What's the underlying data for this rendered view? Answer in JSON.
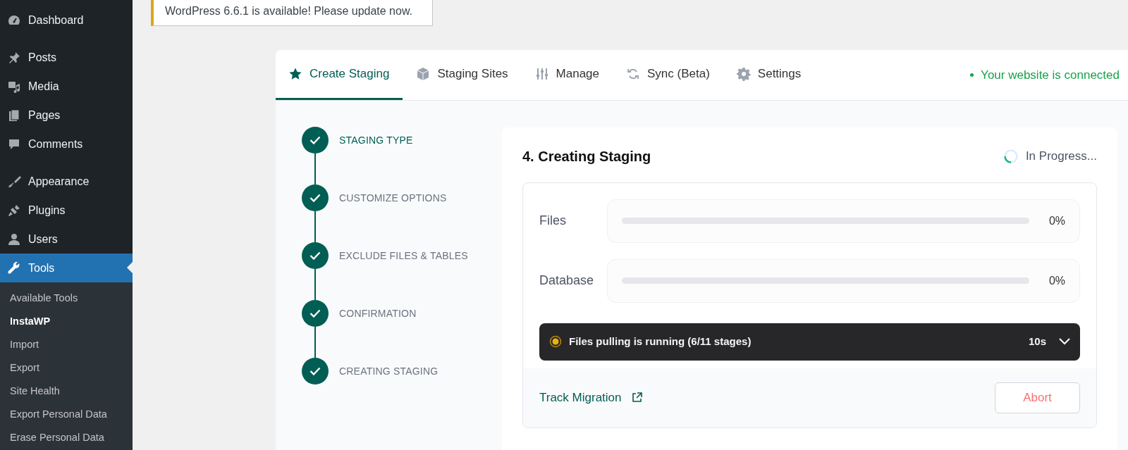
{
  "sidebar": {
    "items": [
      {
        "label": "Dashboard",
        "selected": false
      },
      {
        "label": "Posts",
        "selected": false
      },
      {
        "label": "Media",
        "selected": false
      },
      {
        "label": "Pages",
        "selected": false
      },
      {
        "label": "Comments",
        "selected": false
      },
      {
        "label": "Appearance",
        "selected": false
      },
      {
        "label": "Plugins",
        "selected": false
      },
      {
        "label": "Users",
        "selected": false
      },
      {
        "label": "Tools",
        "selected": true
      }
    ],
    "submenu": [
      {
        "label": "Available Tools",
        "selected": false
      },
      {
        "label": "InstaWP",
        "selected": true
      },
      {
        "label": "Import",
        "selected": false
      },
      {
        "label": "Export",
        "selected": false
      },
      {
        "label": "Site Health",
        "selected": false
      },
      {
        "label": "Export Personal Data",
        "selected": false
      },
      {
        "label": "Erase Personal Data",
        "selected": false
      }
    ]
  },
  "notice": "WordPress 6.6.1 is available! Please update now.",
  "tabs": [
    {
      "label": "Create Staging",
      "selected": true
    },
    {
      "label": "Staging Sites",
      "selected": false
    },
    {
      "label": "Manage",
      "selected": false
    },
    {
      "label": "Sync (Beta)",
      "selected": false
    },
    {
      "label": "Settings",
      "selected": false
    }
  ],
  "connection_status": "Your website is connected",
  "steps": [
    {
      "label": "STAGING TYPE",
      "done": true,
      "selected": true
    },
    {
      "label": "CUSTOMIZE OPTIONS",
      "done": true,
      "selected": false
    },
    {
      "label": "EXCLUDE FILES & TABLES",
      "done": true,
      "selected": false
    },
    {
      "label": "CONFIRMATION",
      "done": true,
      "selected": false
    },
    {
      "label": "CREATING STAGING",
      "done": true,
      "selected": false
    }
  ],
  "panel": {
    "title": "4. Creating Staging",
    "status": "In Progress...",
    "progress": [
      {
        "label": "Files",
        "level": 0,
        "reading": "0%"
      },
      {
        "label": "Database",
        "level": 0,
        "reading": "0%"
      }
    ],
    "activity": {
      "text": "Files pulling is running (6/11 stages)",
      "time": "10s",
      "expanded": false
    },
    "track_link": "Track Migration",
    "abort_button": "Abort"
  }
}
